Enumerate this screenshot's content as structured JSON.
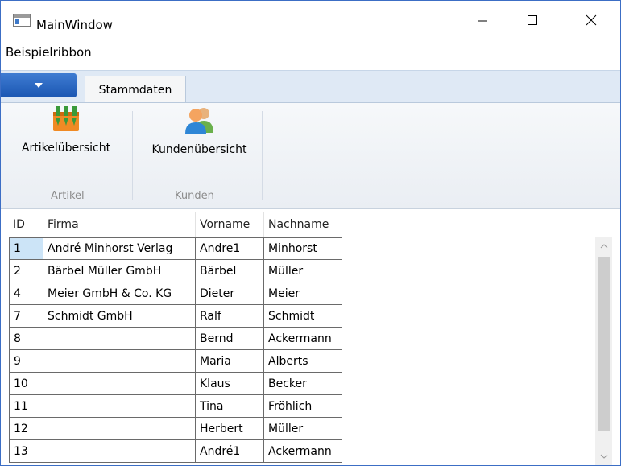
{
  "window": {
    "title": "MainWindow"
  },
  "menu": {
    "label": "Beispielribbon"
  },
  "ribbon": {
    "tab_label": "Stammdaten",
    "groups": [
      {
        "label": "Artikel",
        "button_label": "Artikelübersicht",
        "icon": "products-icon"
      },
      {
        "label": "Kunden",
        "button_label": "Kundenübersicht",
        "icon": "customers-icon"
      }
    ]
  },
  "grid": {
    "columns": [
      "ID",
      "Firma",
      "Vorname",
      "Nachname"
    ],
    "rows": [
      [
        "1",
        "André Minhorst Verlag",
        "Andre1",
        "Minhorst"
      ],
      [
        "2",
        "Bärbel Müller GmbH",
        "Bärbel",
        "Müller"
      ],
      [
        "4",
        "Meier GmbH & Co. KG",
        "Dieter",
        "Meier"
      ],
      [
        "7",
        "Schmidt GmbH",
        "Ralf",
        "Schmidt"
      ],
      [
        "8",
        "",
        "Bernd",
        "Ackermann"
      ],
      [
        "9",
        "",
        "Maria",
        "Alberts"
      ],
      [
        "10",
        "",
        "Klaus",
        "Becker"
      ],
      [
        "11",
        "",
        "Tina",
        "Fröhlich"
      ],
      [
        "12",
        "",
        "Herbert",
        "Müller"
      ],
      [
        "13",
        "",
        "André1",
        "Ackermann"
      ]
    ]
  },
  "colors": {
    "accent": "#2b6ccf",
    "ribbon_bg": "#dfe9f5",
    "selected_cell": "#cce4f7"
  }
}
